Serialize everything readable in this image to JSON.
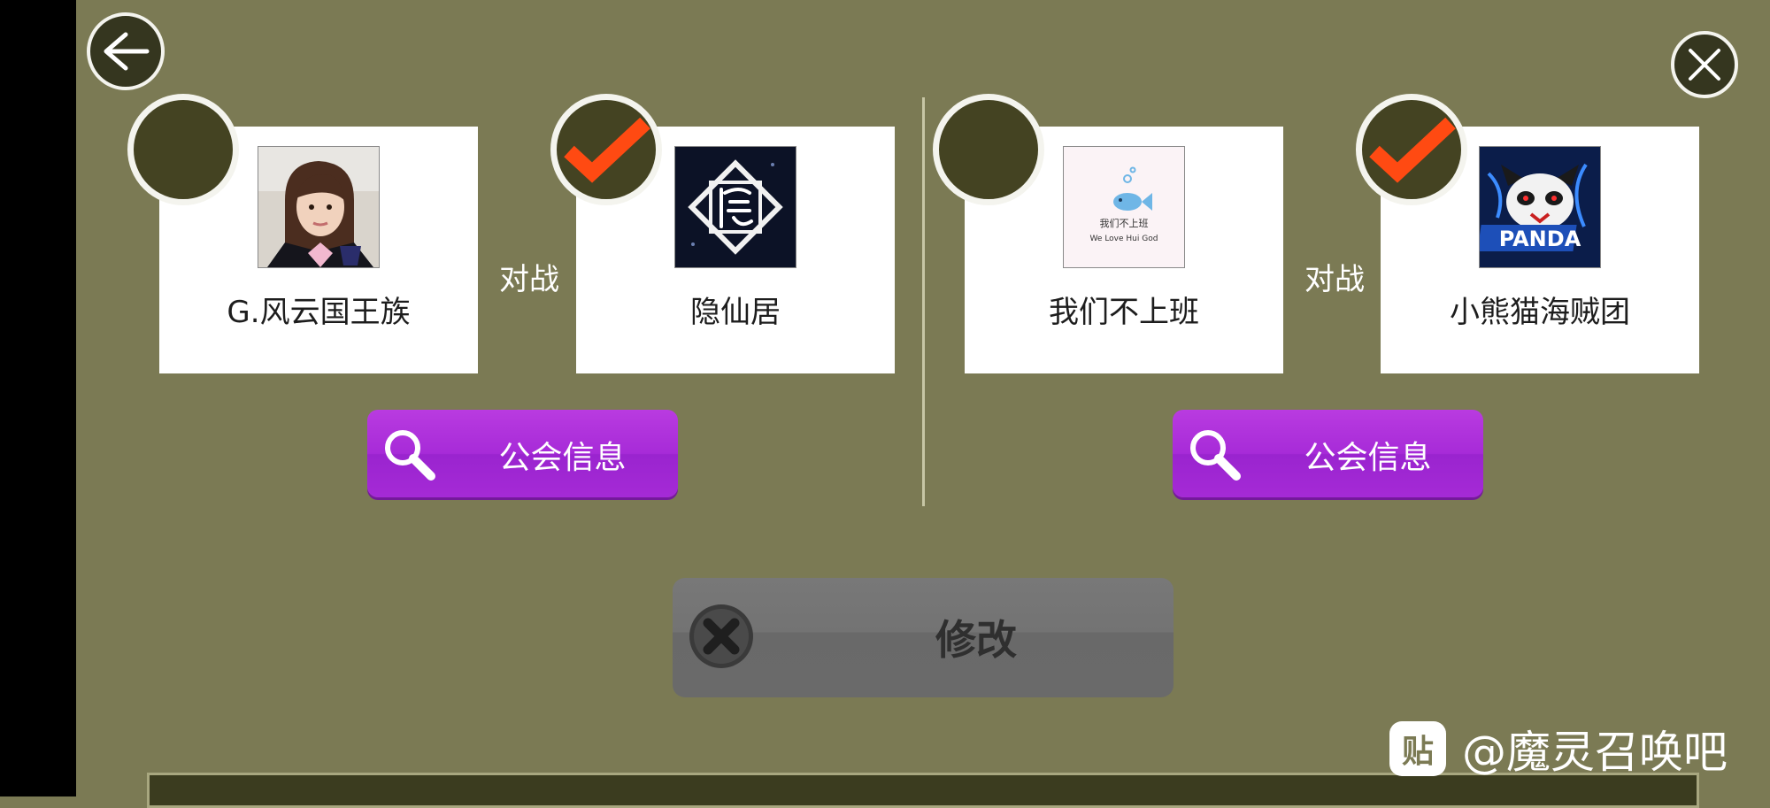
{
  "match_1": {
    "left_team": {
      "name": "G.风云国王族",
      "selected": false
    },
    "vs_label": "对战",
    "right_team": {
      "name": "隐仙居",
      "selected": true
    },
    "guild_info_label": "公会信息"
  },
  "match_2": {
    "left_team": {
      "name": "我们不上班",
      "selected": false,
      "avatar_text_1": "我们不上班",
      "avatar_text_2": "We Love Hui God"
    },
    "vs_label": "对战",
    "right_team": {
      "name": "小熊猫海贼团",
      "selected": true,
      "avatar_text": "PANDA"
    },
    "guild_info_label": "公会信息"
  },
  "modify_button": {
    "label": "修改"
  },
  "watermark": {
    "logo": "贴",
    "text": "@魔灵召唤吧"
  },
  "colors": {
    "background": "#7b7a54",
    "check": "#ff4a12",
    "purple": "#a72bd8",
    "gray_button": "#707070"
  }
}
